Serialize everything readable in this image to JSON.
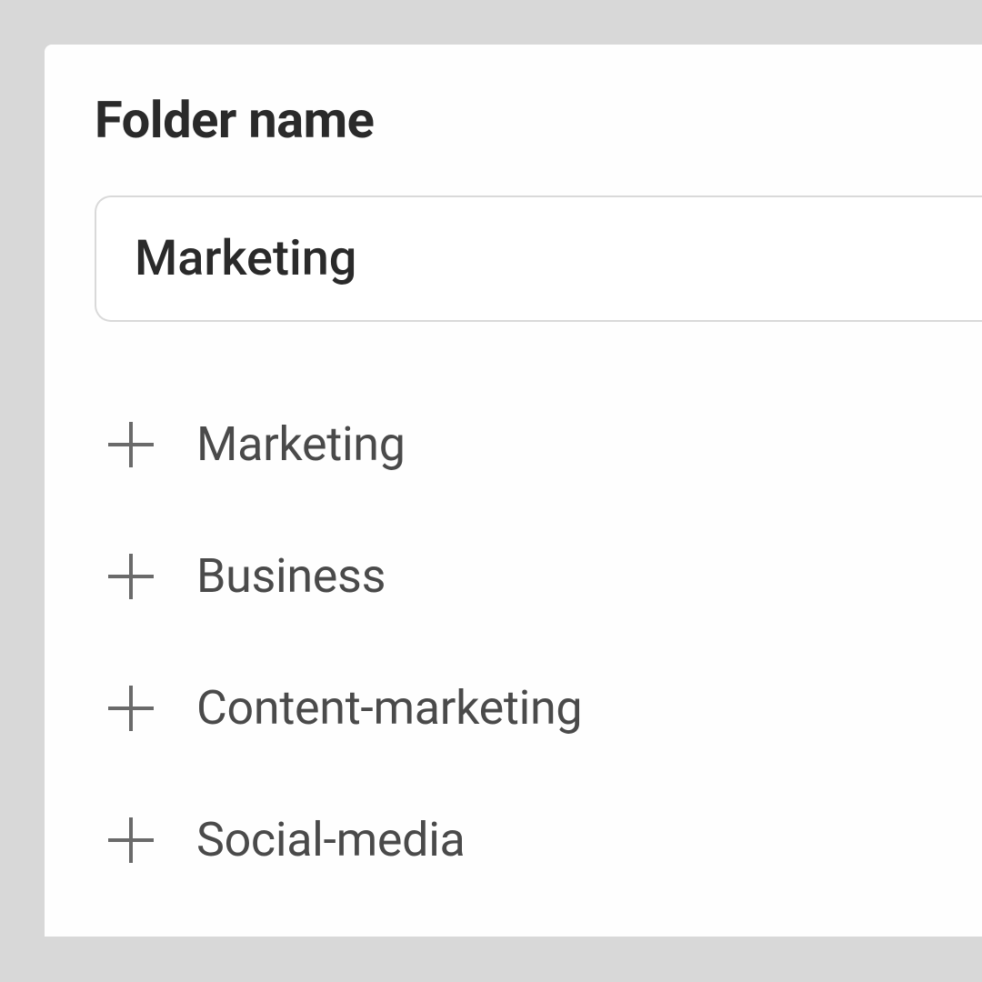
{
  "dialog": {
    "title": "Folder name",
    "input_value": "Marketing",
    "suggestions": [
      {
        "label": "Marketing"
      },
      {
        "label": "Business"
      },
      {
        "label": "Content-marketing"
      },
      {
        "label": "Social-media"
      }
    ]
  }
}
